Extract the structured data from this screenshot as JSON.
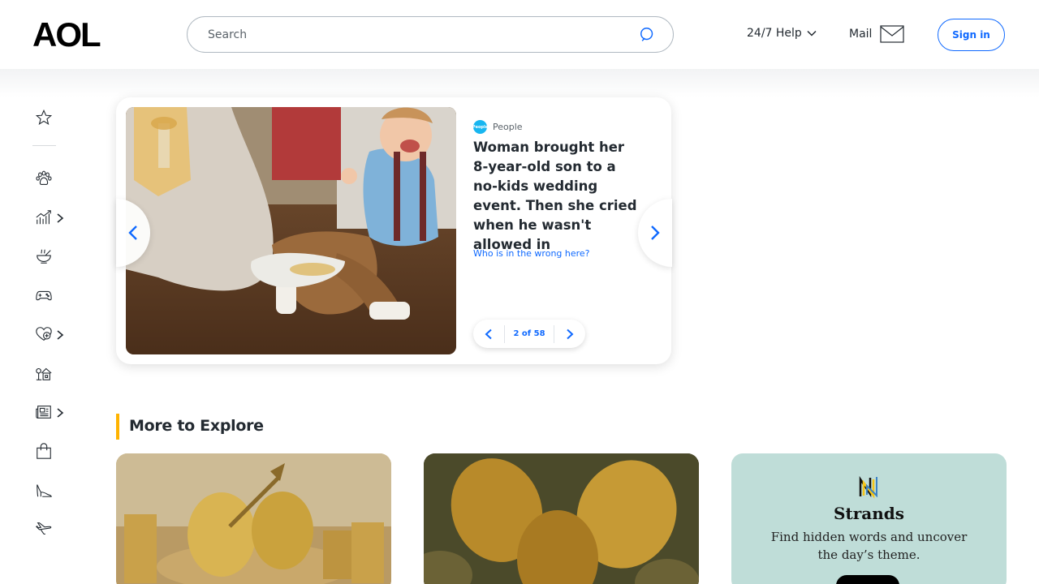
{
  "header": {
    "logo": "AOL",
    "search_placeholder": "Search",
    "help_label": "24/7 Help",
    "mail_label": "Mail",
    "signin_label": "Sign in"
  },
  "sidebar": {
    "items": [
      {
        "icon": "star-icon"
      },
      {
        "icon": "paw-icon"
      },
      {
        "icon": "finance-chart-icon",
        "has_submenu": true
      },
      {
        "icon": "food-bowl-icon"
      },
      {
        "icon": "gamepad-icon"
      },
      {
        "icon": "health-heart-icon",
        "has_submenu": true
      },
      {
        "icon": "home-garden-icon"
      },
      {
        "icon": "news-icon",
        "has_submenu": true
      },
      {
        "icon": "shopping-bag-icon"
      },
      {
        "icon": "high-heel-icon"
      },
      {
        "icon": "airplane-icon"
      }
    ]
  },
  "carousel": {
    "source": "People",
    "source_logo_text": "People",
    "headline": "Woman brought her 8-year-old son to a no-kids wedding event. Then she cried when he wasn't allowed in",
    "subline": "Who is in the wrong here?",
    "pager": "2 of 58"
  },
  "explore": {
    "title": "More to Explore",
    "tiles": [
      {
        "name": "golden-eggs-nest"
      },
      {
        "name": "golden-eggs"
      },
      {
        "name": "strands",
        "title": "Strands",
        "description": "Find hidden words and uncover the day’s theme."
      }
    ]
  },
  "colors": {
    "accent": "#0f69ff",
    "section_bar": "#ffb300",
    "strands_bg": "#bfddd8"
  }
}
